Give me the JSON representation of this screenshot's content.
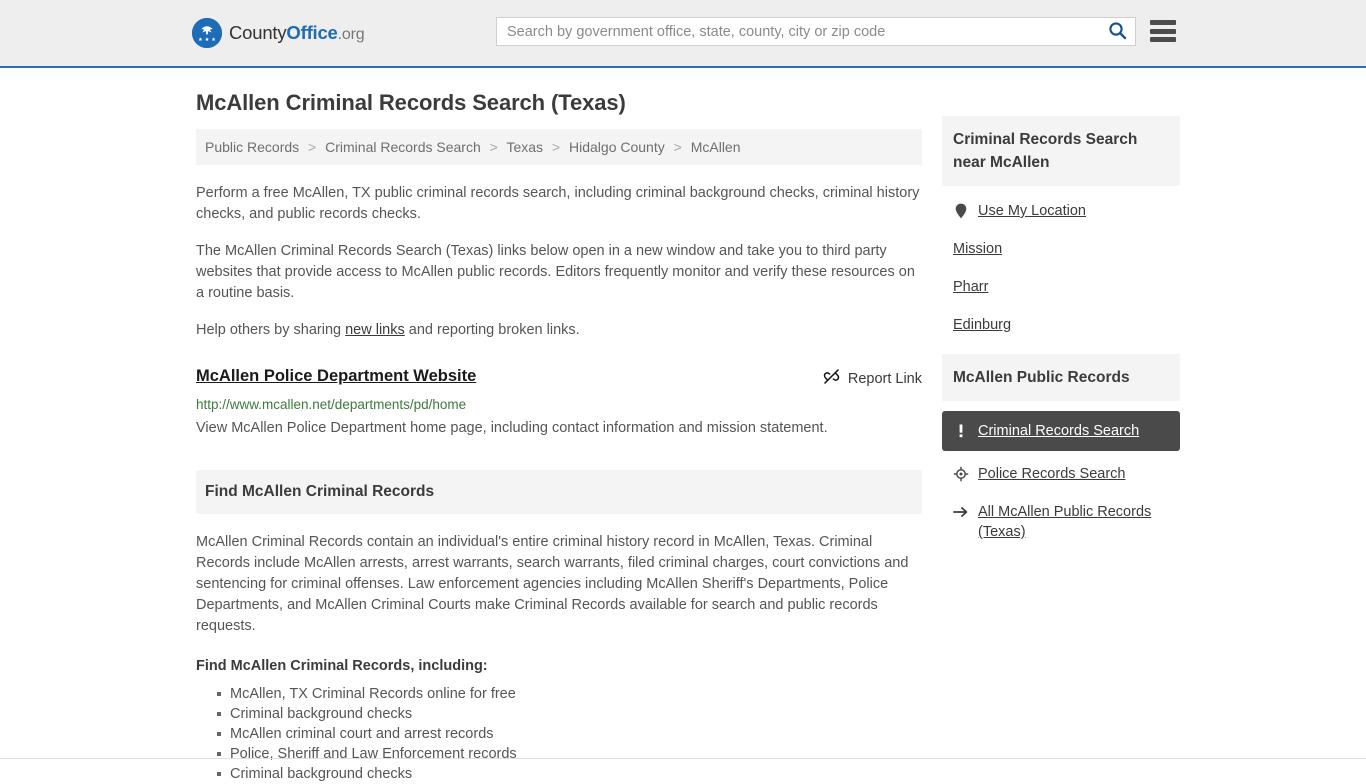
{
  "header": {
    "brand": {
      "part1": "County",
      "part2": "Office",
      "part3": ".org",
      "logo_icon": "eagle-seal-icon"
    },
    "search": {
      "placeholder": "Search by government office, state, county, city or zip code",
      "value": "",
      "icon": "search-icon"
    },
    "menu_icon": "hamburger-menu-icon",
    "accent_color": "#2a6ebb",
    "background_color": "#eeeeee"
  },
  "page": {
    "title": "McAllen Criminal Records Search (Texas)"
  },
  "breadcrumb": {
    "separator": ">",
    "items": [
      {
        "label": "Public Records"
      },
      {
        "label": "Criminal Records Search"
      },
      {
        "label": "Texas"
      },
      {
        "label": "Hidalgo County"
      },
      {
        "label": "McAllen"
      }
    ]
  },
  "intro": {
    "paragraph1": "Perform a free McAllen, TX public criminal records search, including criminal background checks, criminal history checks, and public records checks.",
    "paragraph2": "The McAllen Criminal Records Search (Texas) links below open in a new window and take you to third party websites that provide access to McAllen public records. Editors frequently monitor and verify these resources on a routine basis.",
    "paragraph3_pre": "Help others by sharing ",
    "paragraph3_link": "new links",
    "paragraph3_post": " and reporting broken links."
  },
  "result": {
    "title": "McAllen Police Department Website",
    "url": "http://www.mcallen.net/departments/pd/home",
    "description": "View McAllen Police Department home page, including contact information and mission statement.",
    "report": {
      "label": "Report Link",
      "icon": "broken-link-icon"
    },
    "url_color": "#3b7a3b"
  },
  "section": {
    "heading": "Find McAllen Criminal Records",
    "body": "McAllen Criminal Records contain an individual's entire criminal history record in McAllen, Texas. Criminal Records include McAllen arrests, arrest warrants, search warrants, filed criminal charges, court convictions and sentencing for criminal offenses. Law enforcement agencies including McAllen Sheriff's Departments, Police Departments, and McAllen Criminal Courts make Criminal Records available for search and public records requests.",
    "sub_heading": "Find McAllen Criminal Records, including:",
    "bullets": [
      "McAllen, TX Criminal Records online for free",
      "Criminal background checks",
      "McAllen criminal court and arrest records",
      "Police, Sheriff and Law Enforcement records",
      "Criminal background checks"
    ]
  },
  "sidebar": {
    "nearby": {
      "heading": "Criminal Records Search near McAllen",
      "items": [
        {
          "label": "Use My Location",
          "icon": "map-pin-icon",
          "has_icon": true
        },
        {
          "label": "Mission",
          "icon": "",
          "has_icon": false
        },
        {
          "label": "Pharr",
          "icon": "",
          "has_icon": false
        },
        {
          "label": "Edinburg",
          "icon": "",
          "has_icon": false
        }
      ]
    },
    "public_records": {
      "heading": "McAllen Public Records",
      "active_background": "#4a4a4a",
      "items": [
        {
          "label": "Criminal Records Search",
          "icon": "exclamation-icon",
          "has_icon": true,
          "active": true
        },
        {
          "label": "Police Records Search",
          "icon": "police-badge-icon",
          "has_icon": true,
          "active": false
        },
        {
          "label": "All McAllen Public Records (Texas)",
          "icon": "arrow-right-icon",
          "has_icon": true,
          "active": false
        }
      ]
    }
  }
}
